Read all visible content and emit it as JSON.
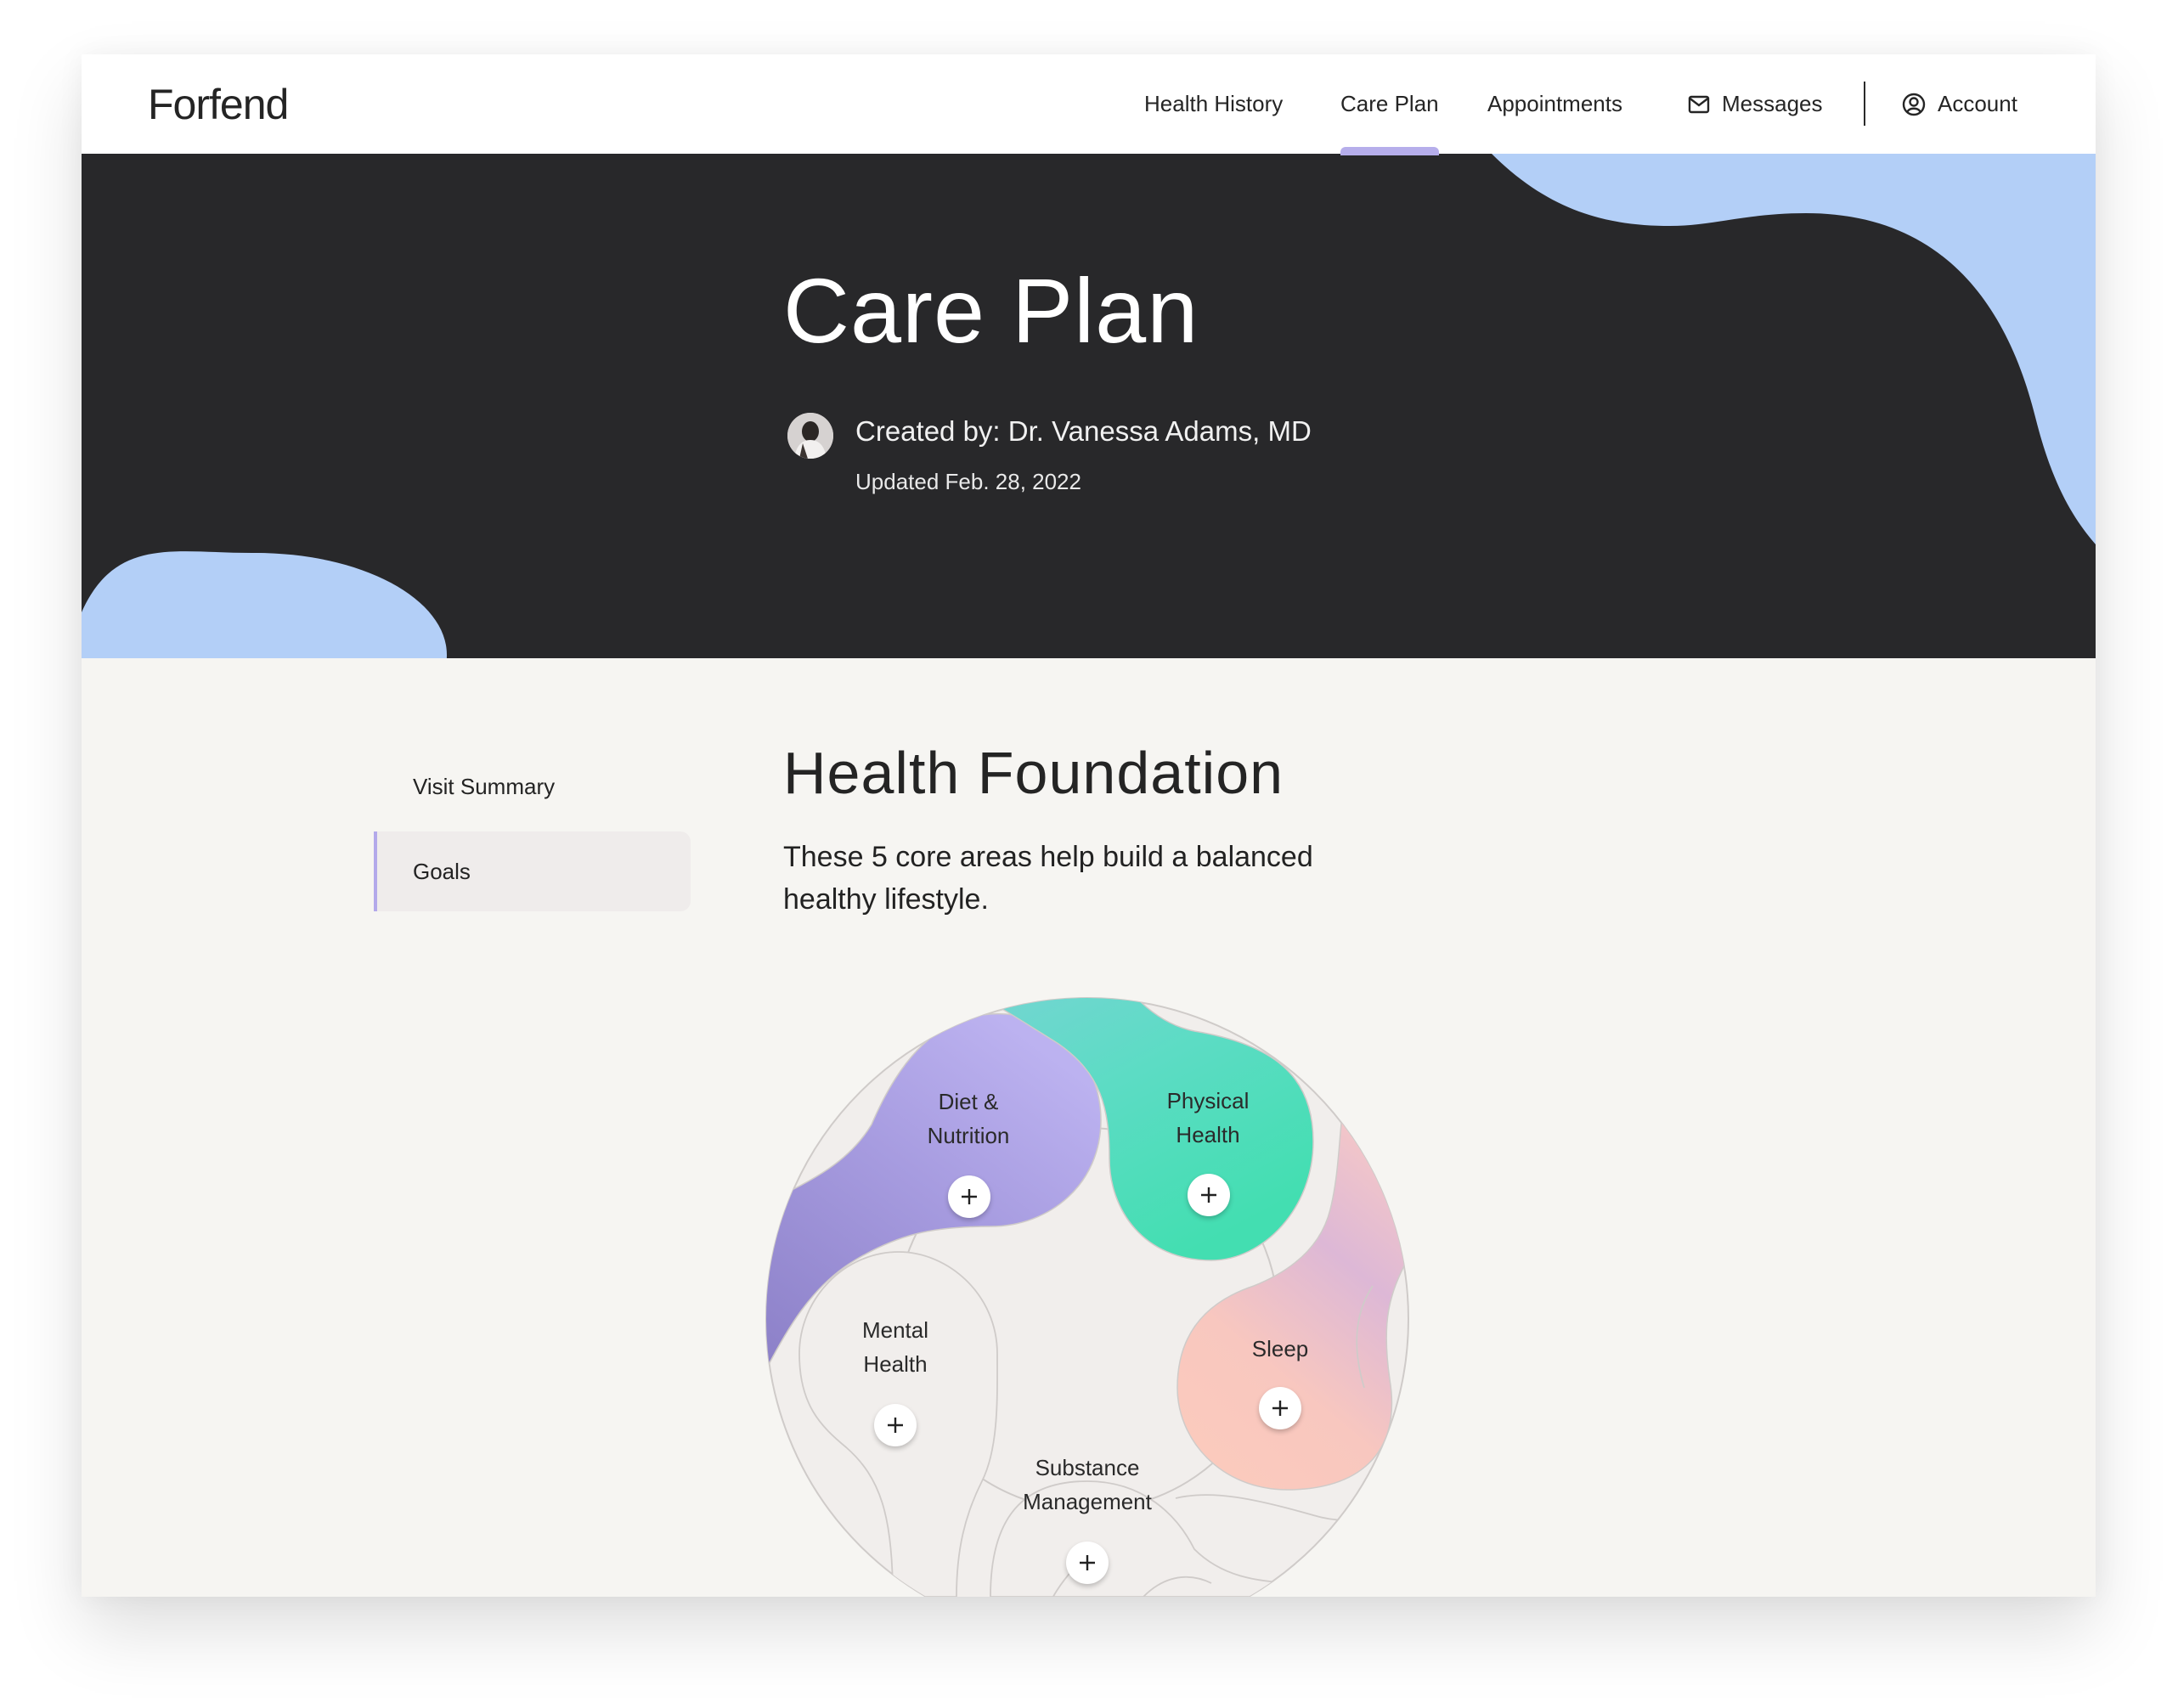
{
  "brand": {
    "logo": "Forfend"
  },
  "nav": {
    "items": [
      {
        "label": "Health History",
        "active": false
      },
      {
        "label": "Care Plan",
        "active": true
      },
      {
        "label": "Appointments",
        "active": false
      },
      {
        "label": "Messages",
        "icon": "mail-icon",
        "active": false
      },
      {
        "label": "Account",
        "icon": "user-circle-icon",
        "active": false
      }
    ]
  },
  "hero": {
    "title": "Care Plan",
    "created_by": "Created by: Dr. Vanessa Adams, MD",
    "updated": "Updated Feb. 28, 2022",
    "colors": {
      "background": "#28282a",
      "blob": "#b3cff7"
    }
  },
  "sidebar": {
    "items": [
      {
        "label": "Visit Summary",
        "active": false
      },
      {
        "label": "Goals",
        "active": true
      }
    ]
  },
  "section": {
    "title": "Health Foundation",
    "description": "These 5 core areas help build a balanced healthy lifestyle."
  },
  "wheel": {
    "segments": [
      {
        "line1": "Diet &",
        "line2": "Nutrition",
        "color": "#b4a8ec",
        "action_icon": "plus-icon"
      },
      {
        "line1": "Physical",
        "line2": "Health",
        "color": "#45dcb4",
        "action_icon": "plus-icon"
      },
      {
        "line1": "Sleep",
        "line2": "",
        "color": "#f9c7bd",
        "action_icon": "plus-icon"
      },
      {
        "line1": "Substance",
        "line2": "Management",
        "color": "#f1eeec",
        "action_icon": "plus-icon"
      },
      {
        "line1": "Mental",
        "line2": "Health",
        "color": "#f1eeec",
        "action_icon": "plus-icon"
      }
    ]
  }
}
